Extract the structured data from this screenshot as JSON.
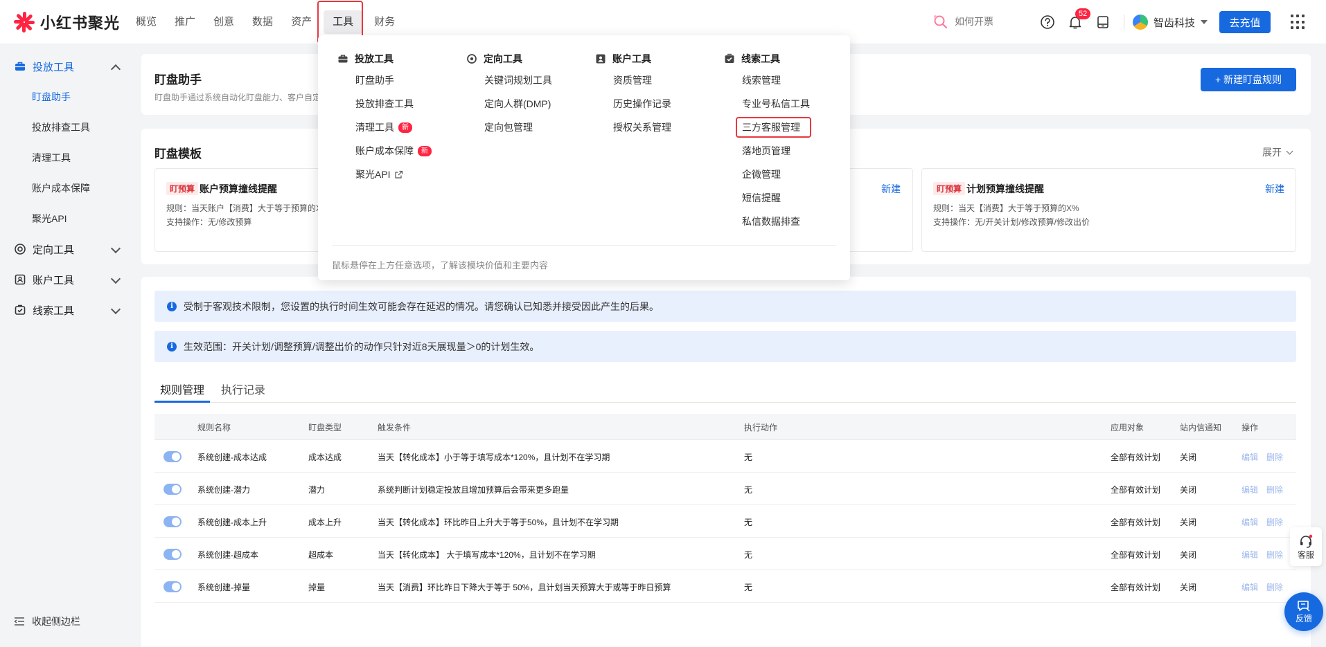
{
  "brand": {
    "name": "小红书聚光"
  },
  "nav": [
    "概览",
    "推广",
    "创意",
    "数据",
    "资产",
    "工具",
    "财务"
  ],
  "search": {
    "placeholder": "如何开票"
  },
  "notifications": {
    "count": "52"
  },
  "account": {
    "name": "智齿科技"
  },
  "recharge_label": "去充值",
  "sidebar": {
    "groups": [
      {
        "label": "投放工具",
        "items": [
          "盯盘助手",
          "投放排查工具",
          "清理工具",
          "账户成本保障",
          "聚光API"
        ]
      },
      {
        "label": "定向工具"
      },
      {
        "label": "账户工具"
      },
      {
        "label": "线索工具"
      }
    ],
    "collapse_label": "收起侧边栏"
  },
  "page": {
    "title": "盯盘助手",
    "desc": "盯盘助手通过系统自动化盯盘能力、客户自定",
    "new_rule_label": "+ 新建盯盘规则"
  },
  "templates": {
    "title": "盯盘模板",
    "expand_label": "展开",
    "cards": [
      {
        "tag": "盯预算",
        "name": "账户预算撞线提醒",
        "rule": "规则：当天账户【消费】大于等于预算的X",
        "ops": "支持操作：无/修改预算"
      },
      {
        "new_label": "新建"
      },
      {
        "tag": "盯预算",
        "name": "计划预算撞线提醒",
        "rule": "规则：当天【消费】大于等于预算的X%",
        "ops": "支持操作：无/开关计划/修改预算/修改出价",
        "new_label": "新建"
      }
    ]
  },
  "notices": [
    "受制于客观技术限制，您设置的执行时间生效可能会存在延迟的情况。请您确认已知悉并接受因此产生的后果。",
    "生效范围：开关计划/调整预算/调整出价的动作只针对近8天展现量＞0的计划生效。"
  ],
  "tabs": [
    "规则管理",
    "执行记录"
  ],
  "table": {
    "columns": [
      "规则名称",
      "盯盘类型",
      "触发条件",
      "执行动作",
      "应用对象",
      "站内信通知",
      "操作"
    ],
    "rows": [
      {
        "name": "系统创建-成本达成",
        "type": "成本达成",
        "cond": "当天【转化成本】小于等于填写成本*120%，且计划不在学习期",
        "action": "无",
        "target": "全部有效计划",
        "notify": "关闭"
      },
      {
        "name": "系统创建-潜力",
        "type": "潜力",
        "cond": "系统判断计划稳定投放且增加预算后会带来更多跑量",
        "action": "无",
        "target": "全部有效计划",
        "notify": "关闭"
      },
      {
        "name": "系统创建-成本上升",
        "type": "成本上升",
        "cond": "当天【转化成本】环比昨日上升大于等于50%，且计划不在学习期",
        "action": "无",
        "target": "全部有效计划",
        "notify": "关闭"
      },
      {
        "name": "系统创建-超成本",
        "type": "超成本",
        "cond": "当天【转化成本】 大于填写成本*120%，且计划不在学习期",
        "action": "无",
        "target": "全部有效计划",
        "notify": "关闭"
      },
      {
        "name": "系统创建-掉量",
        "type": "掉量",
        "cond": "当天【消费】环比昨日下降大于等于 50%，且计划当天预算大于或等于昨日预算",
        "action": "无",
        "target": "全部有效计划",
        "notify": "关闭"
      }
    ],
    "edit_label": "编辑",
    "delete_label": "删除"
  },
  "dropdown": {
    "columns": [
      {
        "title": "投放工具",
        "icon": "briefcase-icon",
        "items": [
          {
            "label": "盯盘助手"
          },
          {
            "label": "投放排查工具"
          },
          {
            "label": "清理工具",
            "tag": "新"
          },
          {
            "label": "账户成本保障",
            "tag": "新"
          },
          {
            "label": "聚光API",
            "external": true
          }
        ]
      },
      {
        "title": "定向工具",
        "icon": "target-icon",
        "items": [
          {
            "label": "关键词规划工具"
          },
          {
            "label": "定向人群(DMP)"
          },
          {
            "label": "定向包管理"
          }
        ]
      },
      {
        "title": "账户工具",
        "icon": "user-card-icon",
        "items": [
          {
            "label": "资质管理"
          },
          {
            "label": "历史操作记录"
          },
          {
            "label": "授权关系管理"
          }
        ]
      },
      {
        "title": "线索工具",
        "icon": "clue-icon",
        "items": [
          {
            "label": "线索管理"
          },
          {
            "label": "专业号私信工具"
          },
          {
            "label": "三方客服管理"
          },
          {
            "label": "落地页管理"
          },
          {
            "label": "企微管理"
          },
          {
            "label": "短信提醒"
          },
          {
            "label": "私信数据排查"
          }
        ]
      }
    ],
    "footer": "鼠标悬停在上方任意选项，了解该模块价值和主要内容"
  },
  "floating": {
    "kefu_label": "客服",
    "feedback_label": "反馈"
  },
  "colors": {
    "primary": "#1769e0",
    "brand": "#ff2442",
    "highlight": "#e6393f"
  }
}
